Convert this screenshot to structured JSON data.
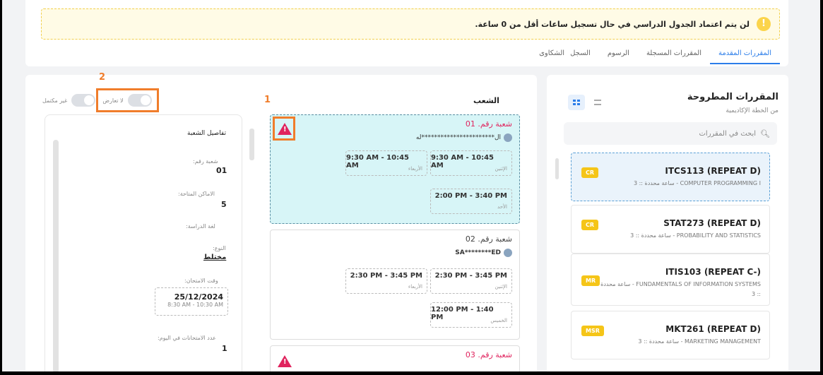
{
  "alert": {
    "icon": "!",
    "text": "لن يتم اعتماد الجدول الدراسي في حال تسجيل ساعات أقل من 0 ساعة."
  },
  "tabs": [
    "المقررات المقدمة",
    "المقررات المسجلة",
    "الرسوم",
    "السجل",
    "الشكاوى"
  ],
  "courses_panel": {
    "title": "المقررات المطروحة",
    "subtitle": "من الخطة الإكاديمية",
    "search_placeholder": "ابحث في المقررات",
    "courses": [
      {
        "code": "ITCS113 (REPEAT D)",
        "desc": "COMPUTER PROGRAMMING I - ساعة محددة :: 3",
        "badge": "CR"
      },
      {
        "code": "STAT273 (REPEAT D)",
        "desc": "PROBABILITY AND STATISTICS - ساعة محددة :: 3",
        "badge": "CR"
      },
      {
        "code": "ITIS103 (REPEAT C-)",
        "desc": "FUNDAMENTALS OF INFORMATION SYSTEMS - ساعة محددة :: 3",
        "badge": "MR"
      },
      {
        "code": "MKT261 (REPEAT D)",
        "desc": "MARKETING MANAGEMENT - ساعة محددة :: 3",
        "badge": "MSR"
      }
    ]
  },
  "sections_panel": {
    "title": "الشعب",
    "sections": [
      {
        "title": "شعبة رقم. 01",
        "instructor": "ال***********************له",
        "slots": [
          {
            "time": "9:30 AM - 10:45 AM",
            "day": "الإثنين"
          },
          {
            "time": "9:30 AM - 10:45 AM",
            "day": "الأربعاء"
          },
          {
            "time": "2:00 PM - 3:40 PM",
            "day": "الأحد"
          }
        ]
      },
      {
        "title": "شعبة رقم. 02",
        "instructor": "SA********ED",
        "slots": [
          {
            "time": "2:30 PM - 3:45 PM",
            "day": "الإثنين"
          },
          {
            "time": "2:30 PM - 3:45 PM",
            "day": "الأربعاء"
          },
          {
            "time": "12:00 PM - 1:40 PM",
            "day": "الخميس"
          }
        ]
      },
      {
        "title": "شعبة رقم. 03"
      }
    ]
  },
  "filters": {
    "no_conflict": "لا تعارض",
    "incomplete": "غير مكتمل"
  },
  "details": {
    "title": "تفاصيل الشعبة",
    "section_label": "شعبة رقم:",
    "section_value": "01",
    "seats_label": "الاماكن المتاحة:",
    "seats_value": "5",
    "language_label": "لغة الدراسة:",
    "gender_label": "النوع:",
    "gender_value": "مختلط",
    "exam_label": "وقت الامتحان:",
    "exam_date": "25/12/2024",
    "exam_time": "8:30 AM - 10:30 AM",
    "exams_count_label": "عدد الامتحانات في اليوم:",
    "exams_count_value": "1"
  },
  "annotations": {
    "one": "1",
    "two": "2"
  },
  "colors": {
    "accent": "#2b7de9",
    "warning": "#e0245e",
    "annotation": "#f07d2b",
    "badge": "#f5c518"
  }
}
